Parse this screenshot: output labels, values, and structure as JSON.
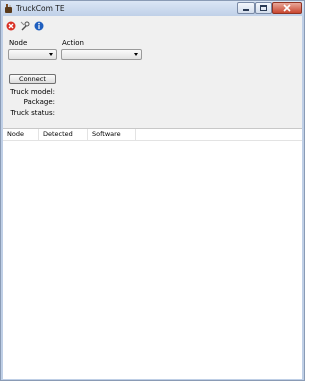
{
  "window": {
    "title": "TruckCom TE",
    "controls": {
      "minimize": "minimize-button",
      "maximize": "maximize-button",
      "close": "close-button"
    }
  },
  "toolbar": {
    "icons": [
      "stop-icon",
      "wrench-icon",
      "info-icon"
    ],
    "colors": {
      "stop": "#d93025",
      "info": "#1f5fbf"
    }
  },
  "form": {
    "node_label": "Node",
    "action_label": "Action",
    "node_value": "",
    "action_value": "",
    "connect_label": "Connect",
    "fields": [
      {
        "label": "Truck model:",
        "value": ""
      },
      {
        "label": "Package:",
        "value": ""
      },
      {
        "label": "Truck status:",
        "value": ""
      }
    ]
  },
  "table": {
    "columns": [
      "Node",
      "Detected",
      "Software",
      ""
    ],
    "rows": []
  }
}
